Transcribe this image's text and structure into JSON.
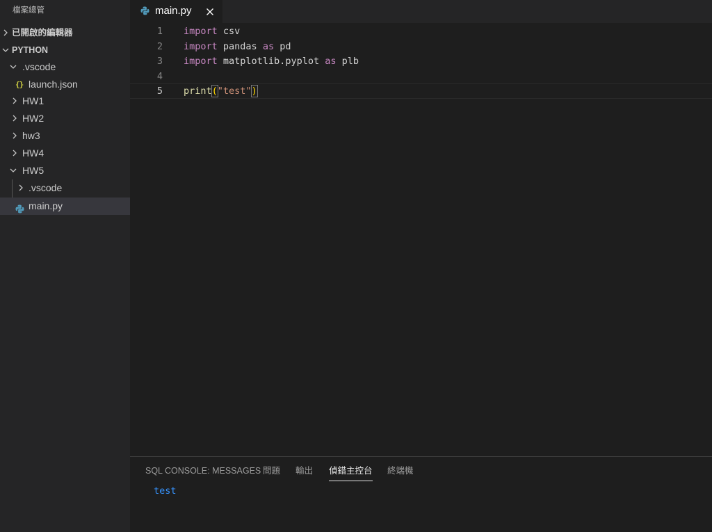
{
  "sidebar": {
    "title": "檔案總管",
    "open_editors": "已開啟的編輯器",
    "root": "PYTHON",
    "items": [
      {
        "label": ".vscode"
      },
      {
        "label": "launch.json"
      },
      {
        "label": "HW1"
      },
      {
        "label": "HW2"
      },
      {
        "label": "hw3"
      },
      {
        "label": "HW4"
      },
      {
        "label": "HW5"
      },
      {
        "label": ".vscode"
      },
      {
        "label": "main.py"
      }
    ],
    "json_icon_text": "{}"
  },
  "editor": {
    "tab": {
      "label": "main.py"
    },
    "lines": [
      {
        "num": "1",
        "kw": "import",
        "rest": " csv"
      },
      {
        "num": "2",
        "kw": "import",
        "rest": " pandas ",
        "kw2": "as",
        "rest2": " pd"
      },
      {
        "num": "3",
        "kw": "import",
        "rest": " matplotlib.pyplot ",
        "kw2": "as",
        "rest2": " plb"
      },
      {
        "num": "4"
      },
      {
        "num": "5",
        "fn": "print",
        "open": "(",
        "str": "\"test\"",
        "close": ")"
      }
    ]
  },
  "panel": {
    "tabs": [
      "SQL CONSOLE: MESSAGES",
      "問題",
      "輸出",
      "偵錯主控台",
      "終端機"
    ],
    "active_tab": "偵錯主控台",
    "output": "test"
  },
  "colors": {
    "background": "#1e1e1e",
    "sidebar": "#252526",
    "keyword": "#c586c0",
    "function": "#dcdcaa",
    "string": "#ce9178",
    "console_output": "#3794ff",
    "json_icon": "#cbcb41",
    "python_icon": "#519aba"
  }
}
